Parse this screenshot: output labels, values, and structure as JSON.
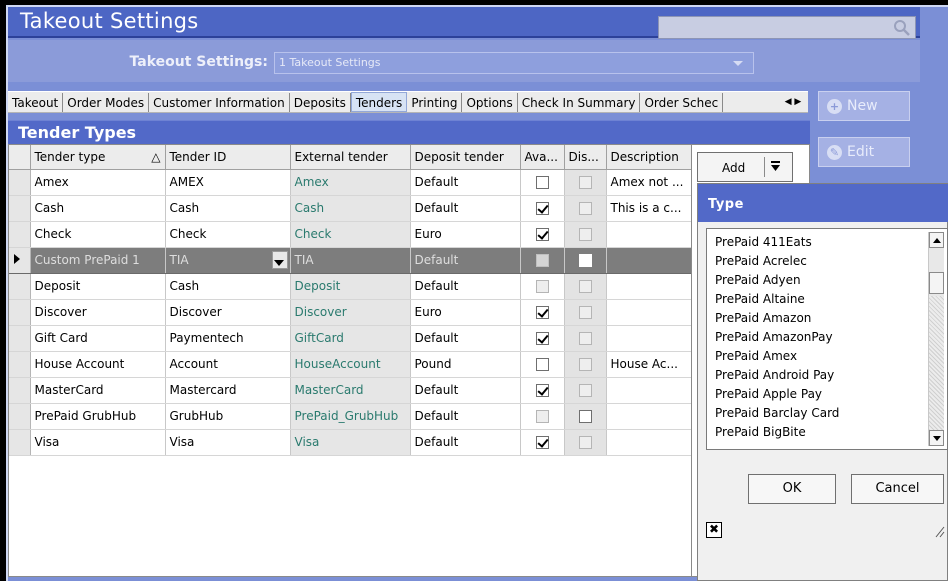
{
  "window": {
    "title": "Takeout Settings"
  },
  "settings": {
    "label": "Takeout Settings:",
    "selected": "1 Takeout Settings"
  },
  "tabs": [
    {
      "label": "Takeout",
      "active": false
    },
    {
      "label": "Order Modes",
      "active": false
    },
    {
      "label": "Customer Information",
      "active": false
    },
    {
      "label": "Deposits",
      "active": false
    },
    {
      "label": "Tenders",
      "active": true
    },
    {
      "label": "Printing",
      "active": false
    },
    {
      "label": "Options",
      "active": false
    },
    {
      "label": "Check In Summary",
      "active": false
    },
    {
      "label": "Order Schec",
      "active": false
    }
  ],
  "side_buttons": {
    "new_label": "New",
    "edit_label": "Edit"
  },
  "tender_types": {
    "header": "Tender Types",
    "columns": [
      "Tender type",
      "Tender ID",
      "External tender",
      "Deposit tender",
      "Ava...",
      "Dis...",
      "Description"
    ],
    "sort_indicator": "△",
    "rows": [
      {
        "type": "Amex",
        "id": "AMEX",
        "external": "Amex",
        "deposit": "Default",
        "available": false,
        "disabled": false,
        "description": "Amex not ..."
      },
      {
        "type": "Cash",
        "id": "Cash",
        "external": "Cash",
        "deposit": "Default",
        "available": true,
        "disabled": false,
        "description": "This is a c..."
      },
      {
        "type": "Check",
        "id": "Check",
        "external": "Check",
        "deposit": "Euro",
        "available": true,
        "disabled": false,
        "description": ""
      },
      {
        "type": "Custom PrePaid 1",
        "id": "TIA",
        "external": "TIA",
        "deposit": "Default",
        "available": false,
        "disabled": false,
        "description": "",
        "current": true
      },
      {
        "type": "Deposit",
        "id": "Cash",
        "external": "Deposit",
        "deposit": "Default",
        "available": false,
        "disabled": false,
        "description": "",
        "available_disabled": true
      },
      {
        "type": "Discover",
        "id": "Discover",
        "external": "Discover",
        "deposit": "Euro",
        "available": true,
        "disabled": false,
        "description": ""
      },
      {
        "type": "Gift Card",
        "id": "Paymentech",
        "external": "GiftCard",
        "deposit": "Default",
        "available": true,
        "disabled": false,
        "description": ""
      },
      {
        "type": "House Account",
        "id": "Account",
        "external": "HouseAccount",
        "deposit": "Pound",
        "available": false,
        "disabled": false,
        "description": "House Ac..."
      },
      {
        "type": "MasterCard",
        "id": "Mastercard",
        "external": "MasterCard",
        "deposit": "Default",
        "available": true,
        "disabled": false,
        "description": ""
      },
      {
        "type": "PrePaid GrubHub",
        "id": "GrubHub",
        "external": "PrePaid_GrubHub",
        "deposit": "Default",
        "available": false,
        "disabled": false,
        "description": "",
        "available_disabled": true,
        "disabled_editable": true
      },
      {
        "type": "Visa",
        "id": "Visa",
        "external": "Visa",
        "deposit": "Default",
        "available": true,
        "disabled": false,
        "description": ""
      }
    ]
  },
  "add_button": {
    "label": "Add"
  },
  "type_popup": {
    "title": "Type",
    "items": [
      "PrePaid 411Eats",
      "PrePaid Acrelec",
      "PrePaid Adyen",
      "PrePaid Altaine",
      "PrePaid Amazon",
      "PrePaid AmazonPay",
      "PrePaid Amex",
      "PrePaid Android Pay",
      "PrePaid Apple Pay",
      "PrePaid Barclay Card",
      "PrePaid BigBite"
    ],
    "ok_label": "OK",
    "cancel_label": "Cancel",
    "close_glyph": "✖"
  },
  "colors": {
    "window_bg": "#7b8fd6",
    "titlebar": "#4d66c4",
    "section_header": "#5269c8",
    "external_text": "#2a7a6e",
    "current_row": "#7d7d7d"
  }
}
